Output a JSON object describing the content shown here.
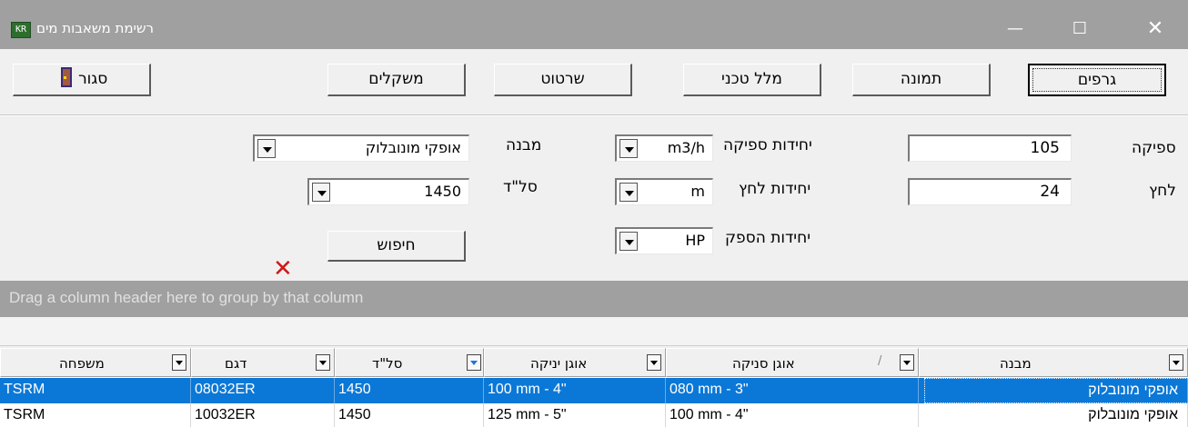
{
  "window": {
    "title": "רשימת משאבות מים",
    "icon_label": "KR",
    "minimize": "—",
    "maximize": "☐",
    "close": "✕"
  },
  "toolbar": {
    "graphs": "גרפים",
    "image": "תמונה",
    "tech_spec": "מלל טכני",
    "drawing": "שרטוט",
    "weights": "משקלים",
    "close": "סגור"
  },
  "form": {
    "flow_label": "ספיקה",
    "flow_value": "105",
    "pressure_label": "לחץ",
    "pressure_value": "24",
    "flow_units_label": "יחידות ספיקה",
    "flow_units_value": "m3/h",
    "pressure_units_label": "יחידות לחץ",
    "pressure_units_value": "m",
    "power_units_label": "יחידות הספק",
    "power_units_value": "HP",
    "structure_label": "מבנה",
    "structure_value": "אופקי מונובלוק",
    "rpm_label": "סל\"ד",
    "rpm_value": "1450",
    "search_button": "חיפוש",
    "clear_icon": "✕"
  },
  "group_panel": {
    "text": "Drag a column header here to group by that column"
  },
  "grid": {
    "columns": [
      "מבנה",
      "אוגן סניקה",
      "אוגן יניקה",
      "סל\"ד",
      "דגם",
      "משפחה"
    ],
    "sort_indicator": "/",
    "rows": [
      {
        "structure": "אופקי מונובלוק",
        "discharge": "080 mm - 3\"",
        "suction": "100 mm - 4\"",
        "rpm": "1450",
        "model": "08032ER",
        "family": "TSRM"
      },
      {
        "structure": "אופקי מונובלוק",
        "discharge": "100 mm - 4\"",
        "suction": "125 mm - 5\"",
        "rpm": "1450",
        "model": "10032ER",
        "family": "TSRM"
      }
    ]
  }
}
